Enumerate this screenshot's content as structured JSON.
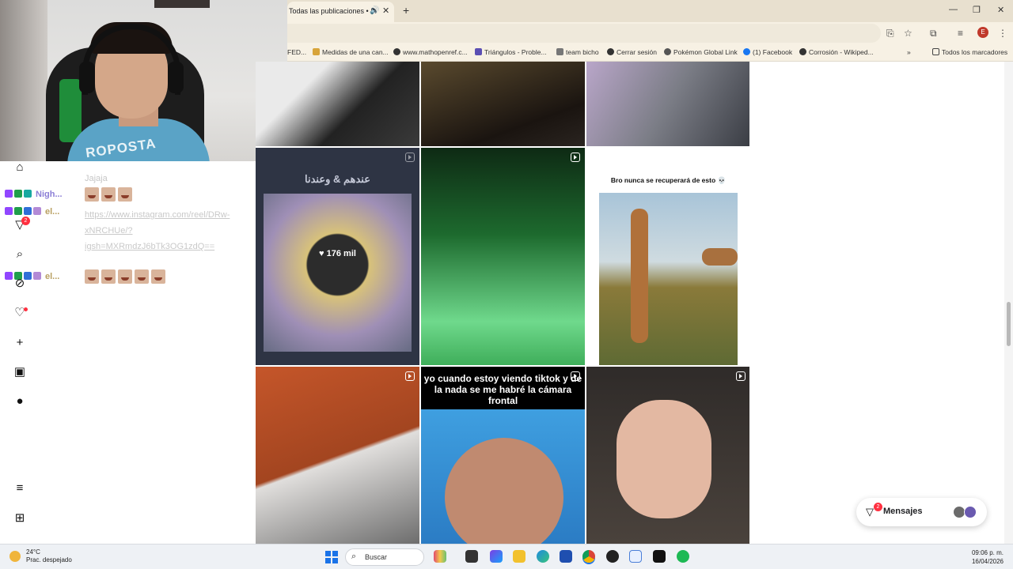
{
  "browser": {
    "tab_title": "Todas las publicaciones • In",
    "bookmarks": [
      "FED...",
      "Medidas de una can...",
      "www.mathopenref.c...",
      "Triángulos - Proble...",
      "team bicho",
      "Cerrar sesión",
      "Pokémon Global Link",
      "(1) Facebook",
      "Corrosión - Wikiped..."
    ],
    "all_bookmarks": "Todos los marcadores",
    "profile_letter": "E"
  },
  "webcam": {
    "shirt_text": "ROPOSTA"
  },
  "chat": {
    "line1_user": "Nigh...",
    "line2_user": "el...",
    "line3_user": "el...",
    "msg_top": "Jajaja",
    "link": "https://www.instagram.com/reel/DRw-xNRCHUe/?igsh=MXRmdzJ6bTk3OG1zdQ=="
  },
  "sidebar": {
    "notification_count": "2"
  },
  "grid": {
    "likes": "176 mil",
    "arabic_caption": "عندهم & وعندنا",
    "bro_caption": "Bro nunca se recuperará de esto 💀",
    "tiktok_caption": "yo cuando estoy viendo tiktok y de la nada se me habré la cámara frontal"
  },
  "messages": {
    "label": "Mensajes",
    "count": "2"
  },
  "taskbar": {
    "temperature": "24°C",
    "weather": "Prac. despejado",
    "search_label": "Buscar",
    "time": "09:06 p. m.",
    "date": "16/04/2026"
  }
}
